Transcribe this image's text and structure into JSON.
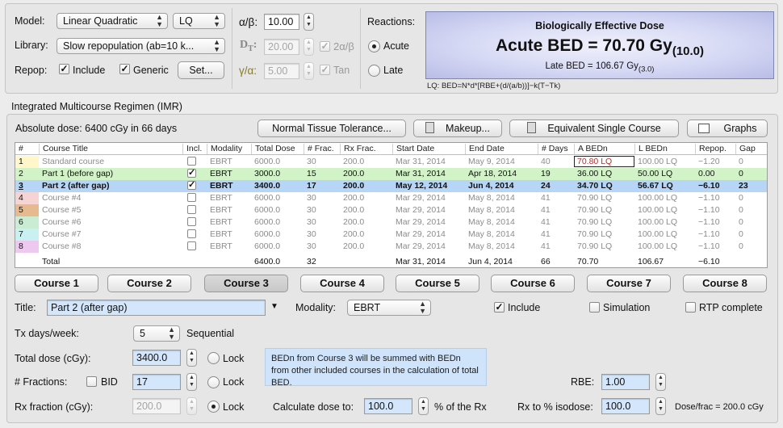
{
  "top": {
    "model_label": "Model:",
    "model_value": "Linear Quadratic",
    "model_code": "LQ",
    "library_label": "Library:",
    "library_value": "Slow repopulation (ab=10 k...",
    "repop_label": "Repop:",
    "include_label": "Include",
    "generic_label": "Generic",
    "set_button": "Set...",
    "alpha_beta_label": "α/β:",
    "alpha_beta_value": "10.00",
    "dt_label": "D",
    "dt_sub": "T",
    "dt_colon": ":",
    "dt_value": "20.00",
    "two_ab_label": "2α/β",
    "gamma_alpha_label": "γ/α:",
    "gamma_alpha_value": "5.00",
    "tan_label": "Tan",
    "reactions_label": "Reactions:",
    "acute_label": "Acute",
    "late_label": "Late"
  },
  "bed": {
    "title": "Biologically Effective Dose",
    "main": "Acute BED = 70.70 Gy",
    "main_sub": "(10.0)",
    "late": "Late BED = 106.67 Gy",
    "late_sub": "(3.0)",
    "formula": "LQ: BED=N*d*[RBE+(d/(a/b))]−k(T−Tk)"
  },
  "imr": {
    "section_title": "Integrated Multicourse Regimen (IMR)",
    "absolute_dose": "Absolute dose:  6400 cGy in 66 days",
    "ntt_button": "Normal Tissue Tolerance...",
    "makeup_button": "Makeup...",
    "esc_button": "Equivalent Single Course",
    "graphs_button": "Graphs"
  },
  "table": {
    "headers": [
      "#",
      "Course Title",
      "Incl.",
      "Modality",
      "Total Dose",
      "# Frac.",
      "Rx Frac.",
      "Start Date",
      "End Date",
      "# Days",
      "A BEDn",
      "L BEDn",
      "Repop.",
      "Gap"
    ],
    "rows": [
      {
        "num": "1",
        "title": "Standard course",
        "incl": "",
        "mod": "EBRT",
        "dose": "6000.0",
        "frac": "30",
        "rx": "200.0",
        "start": "Mar 31, 2014",
        "end": "May 9, 2014",
        "days": "40",
        "abed": "70.80  LQ",
        "lbed": "100.00  LQ",
        "repop": "−1.20",
        "gap": "0"
      },
      {
        "num": "2",
        "title": "Part 1 (before gap)",
        "incl": "✓",
        "mod": "EBRT",
        "dose": "3000.0",
        "frac": "15",
        "rx": "200.0",
        "start": "Mar 31, 2014",
        "end": "Apr 18, 2014",
        "days": "19",
        "abed": "36.00  LQ",
        "lbed": "50.00  LQ",
        "repop": "0.00",
        "gap": "0"
      },
      {
        "num": "3",
        "title": "Part 2 (after gap)",
        "incl": "✓",
        "mod": "EBRT",
        "dose": "3400.0",
        "frac": "17",
        "rx": "200.0",
        "start": "May 12, 2014",
        "end": "Jun 4, 2014",
        "days": "24",
        "abed": "34.70  LQ",
        "lbed": "56.67  LQ",
        "repop": "−6.10",
        "gap": "23"
      },
      {
        "num": "4",
        "title": "Course #4",
        "incl": "",
        "mod": "EBRT",
        "dose": "6000.0",
        "frac": "30",
        "rx": "200.0",
        "start": "Mar 29, 2014",
        "end": "May 8, 2014",
        "days": "41",
        "abed": "70.90  LQ",
        "lbed": "100.00  LQ",
        "repop": "−1.10",
        "gap": "0"
      },
      {
        "num": "5",
        "title": "Course #5",
        "incl": "",
        "mod": "EBRT",
        "dose": "6000.0",
        "frac": "30",
        "rx": "200.0",
        "start": "Mar 29, 2014",
        "end": "May 8, 2014",
        "days": "41",
        "abed": "70.90  LQ",
        "lbed": "100.00  LQ",
        "repop": "−1.10",
        "gap": "0"
      },
      {
        "num": "6",
        "title": "Course #6",
        "incl": "",
        "mod": "EBRT",
        "dose": "6000.0",
        "frac": "30",
        "rx": "200.0",
        "start": "Mar 29, 2014",
        "end": "May 8, 2014",
        "days": "41",
        "abed": "70.90  LQ",
        "lbed": "100.00  LQ",
        "repop": "−1.10",
        "gap": "0"
      },
      {
        "num": "7",
        "title": "Course #7",
        "incl": "",
        "mod": "EBRT",
        "dose": "6000.0",
        "frac": "30",
        "rx": "200.0",
        "start": "Mar 29, 2014",
        "end": "May 8, 2014",
        "days": "41",
        "abed": "70.90  LQ",
        "lbed": "100.00  LQ",
        "repop": "−1.10",
        "gap": "0"
      },
      {
        "num": "8",
        "title": "Course #8",
        "incl": "",
        "mod": "EBRT",
        "dose": "6000.0",
        "frac": "30",
        "rx": "200.0",
        "start": "Mar 29, 2014",
        "end": "May 8, 2014",
        "days": "41",
        "abed": "70.90  LQ",
        "lbed": "100.00  LQ",
        "repop": "−1.10",
        "gap": "0"
      }
    ],
    "row_colors": [
      "#ffffff",
      "#d2f2c8",
      "#b6d5f7",
      "#f7d4d4",
      "#e8c1a1",
      "#c9ecd3",
      "#c9f1f1",
      "#efc8ef"
    ],
    "num_colors": [
      "#fff7c9",
      "#d2f2c8",
      "#b6d5f7",
      "#f7d4d4",
      "#e6b98f",
      "#c9ecd3",
      "#c9f1f1",
      "#efc8ef"
    ],
    "total": {
      "label": "Total",
      "dose": "6400.0",
      "frac": "32",
      "start": "Mar 31, 2014",
      "end": "Jun 4, 2014",
      "days": "66",
      "abed": "70.70",
      "lbed": "106.67",
      "repop": "−6.10"
    }
  },
  "course_buttons": [
    "Course 1",
    "Course 2",
    "Course 3",
    "Course 4",
    "Course 5",
    "Course 6",
    "Course 7",
    "Course 8"
  ],
  "detail": {
    "title_label": "Title:",
    "title_value": "Part 2 (after gap)",
    "modality_label": "Modality:",
    "modality_value": "EBRT",
    "include_label": "Include",
    "simulation_label": "Simulation",
    "rtp_label": "RTP complete",
    "tx_days_label": "Tx days/week:",
    "tx_days_value": "5",
    "sequential_label": "Sequential",
    "total_dose_label": "Total dose (cGy):",
    "total_dose_value": "3400.0",
    "lock_label": "Lock",
    "fractions_label": "# Fractions:",
    "bid_label": "BID",
    "fractions_value": "17",
    "rx_fraction_label": "Rx fraction (cGy):",
    "rx_fraction_value": "200.0",
    "calc_label": "Calculate dose to:",
    "calc_value": "100.0",
    "calc_unit": "% of the Rx",
    "info": "BEDn from Course 3 will be summed with BEDn from other included courses in the calculation of total BED.",
    "rbe_label": "RBE:",
    "rbe_value": "1.00",
    "isodose_label": "Rx to % isodose:",
    "isodose_value": "100.0",
    "dose_frac": "Dose/frac = 200.0 cGy"
  }
}
